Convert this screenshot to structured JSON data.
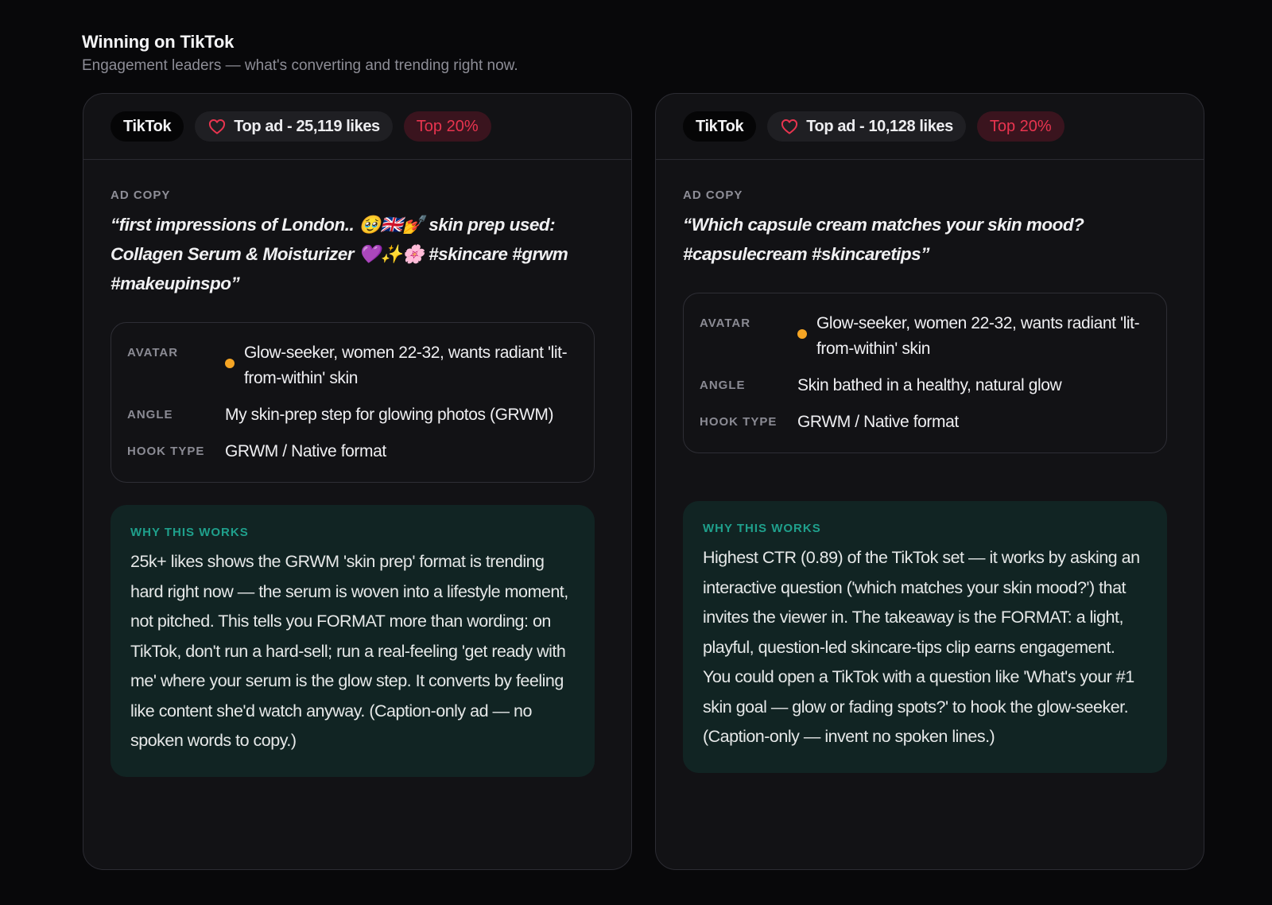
{
  "section": {
    "title": "Winning on TikTok",
    "subtitle": "Engagement leaders — what's converting and trending right now."
  },
  "labels": {
    "ad_copy": "AD COPY",
    "avatar": "AVATAR",
    "angle": "ANGLE",
    "hook_type": "HOOK TYPE",
    "why_this_works": "WHY THIS WORKS"
  },
  "colors": {
    "accent_rank": "#e8344f",
    "accent_dot": "#f5a524",
    "accent_why": "#1fa08c"
  },
  "cards": [
    {
      "platform": "TikTok",
      "likes_label": "Top ad - 25,119 likes",
      "rank": "Top 20%",
      "ad_copy": "“first impressions of London.. 🥹🇬🇧💅 skin prep used: Collagen Serum & Moisturizer 💜✨🌸 #skincare #grwm #makeupinspo”",
      "avatar": "Glow-seeker, women 22-32, wants radiant 'lit-from-within' skin",
      "angle": "My skin-prep step for glowing photos (GRWM)",
      "hook_type": "GRWM / Native format",
      "why": "25k+ likes shows the GRWM 'skin prep' format is trending hard right now — the serum is woven into a lifestyle moment, not pitched. This tells you FORMAT more than wording: on TikTok, don't run a hard-sell; run a real-feeling 'get ready with me' where your serum is the glow step. It converts by feeling like content she'd watch anyway. (Caption-only ad — no spoken words to copy.)"
    },
    {
      "platform": "TikTok",
      "likes_label": "Top ad - 10,128 likes",
      "rank": "Top 20%",
      "ad_copy": "“Which capsule cream matches your skin mood? #capsulecream #skincaretips”",
      "avatar": "Glow-seeker, women 22-32, wants radiant 'lit-from-within' skin",
      "angle": "Skin bathed in a healthy, natural glow",
      "hook_type": "GRWM / Native format",
      "why": "Highest CTR (0.89) of the TikTok set — it works by asking an interactive question ('which matches your skin mood?') that invites the viewer in. The takeaway is the FORMAT: a light, playful, question-led skincare-tips clip earns engagement. You could open a TikTok with a question like 'What's your #1 skin goal — glow or fading spots?' to hook the glow-seeker. (Caption-only — invent no spoken lines.)"
    }
  ]
}
